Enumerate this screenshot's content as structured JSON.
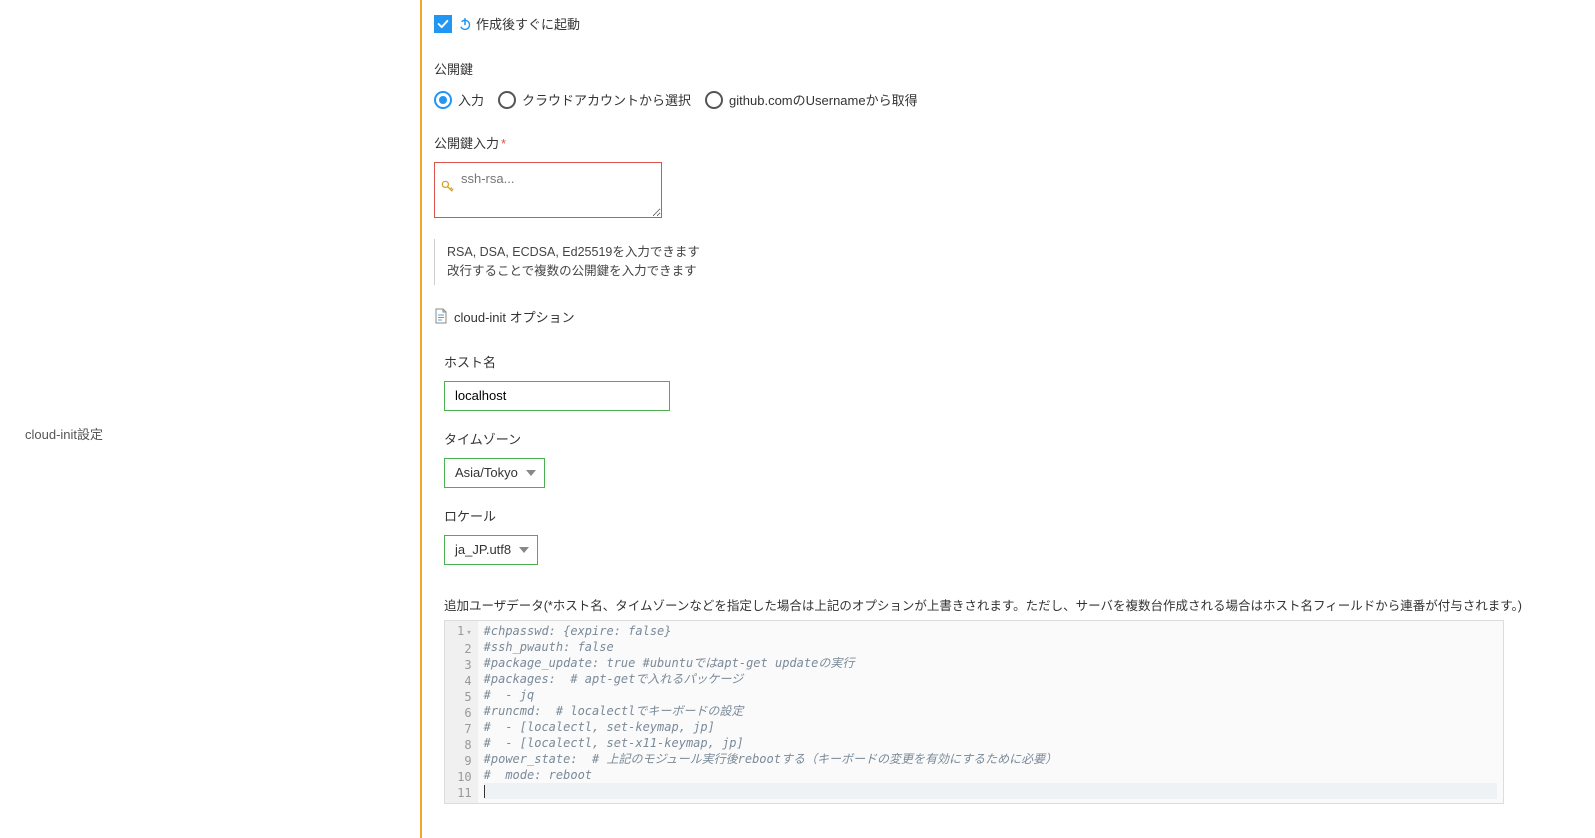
{
  "sidebar": {
    "label": "cloud-init設定"
  },
  "startAfterCreate": {
    "label": "作成後すぐに起動",
    "checked": true
  },
  "publicKey": {
    "heading": "公開鍵",
    "options": {
      "input": "入力",
      "cloudAccount": "クラウドアカウントから選択",
      "github": "github.comのUsernameから取得"
    },
    "selected": "input"
  },
  "publicKeyInput": {
    "label": "公開鍵入力",
    "placeholder": "ssh-rsa...",
    "help1": "RSA, DSA, ECDSA, Ed25519を入力できます",
    "help2": "改行することで複数の公開鍵を入力できます"
  },
  "cloudInitOption": {
    "label": "cloud-init オプション"
  },
  "hostname": {
    "label": "ホスト名",
    "value": "localhost"
  },
  "timezone": {
    "label": "タイムゾーン",
    "value": "Asia/Tokyo"
  },
  "locale": {
    "label": "ロケール",
    "value": "ja_JP.utf8"
  },
  "userdata": {
    "label": "追加ユーザデータ(*ホスト名、タイムゾーンなどを指定した場合は上記のオプションが上書きされます。ただし、サーバを複数台作成される場合はホスト名フィールドから連番が付与されます。)",
    "lines": [
      "#chpasswd: {expire: false}",
      "#ssh_pwauth: false",
      "#package_update: true #ubuntuではapt-get updateの実行",
      "#packages:  # apt-getで入れるパッケージ",
      "#  - jq",
      "#runcmd:  # localectlでキーボードの設定",
      "#  - [localectl, set-keymap, jp]",
      "#  - [localectl, set-x11-keymap, jp]",
      "#power_state:  # 上記のモジュール実行後rebootする（キーボードの変更を有効にするために必要）",
      "#  mode: reboot",
      ""
    ]
  }
}
